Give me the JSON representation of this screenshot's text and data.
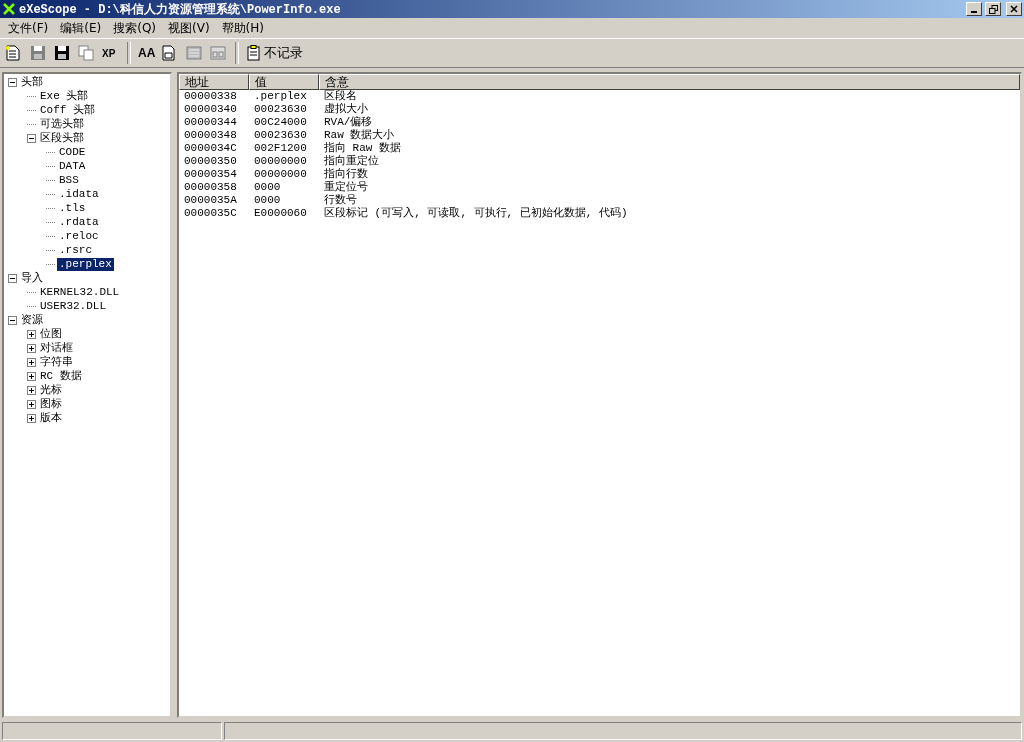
{
  "window": {
    "title": "eXeScope - D:\\科信人力资源管理系统\\PowerInfo.exe"
  },
  "menu": [
    {
      "label": "文件(F)"
    },
    {
      "label": "编辑(E)"
    },
    {
      "label": "搜索(Q)"
    },
    {
      "label": "视图(V)"
    },
    {
      "label": "帮助(H)"
    }
  ],
  "toolbar": [
    {
      "kind": "new",
      "disabled": false
    },
    {
      "kind": "save",
      "disabled": true
    },
    {
      "kind": "save",
      "disabled": false
    },
    {
      "kind": "copy",
      "disabled": true
    },
    {
      "kind": "xp",
      "label": "XP",
      "disabled": false
    },
    {
      "kind": "separator"
    },
    {
      "kind": "font",
      "label": "AA",
      "disabled": false
    },
    {
      "kind": "hex",
      "disabled": false
    },
    {
      "kind": "dump",
      "disabled": true
    },
    {
      "kind": "binary",
      "disabled": true
    },
    {
      "kind": "separator"
    },
    {
      "kind": "record",
      "label": "不记录",
      "disabled": false
    }
  ],
  "tree": [
    {
      "label": "头部",
      "expanded": true,
      "selected": false,
      "children": [
        {
          "label": "Exe 头部",
          "selected": false
        },
        {
          "label": "Coff 头部",
          "selected": false
        },
        {
          "label": "可选头部",
          "selected": false
        },
        {
          "label": "区段头部",
          "expanded": true,
          "selected": false,
          "children": [
            {
              "label": "CODE",
              "selected": false
            },
            {
              "label": "DATA",
              "selected": false
            },
            {
              "label": "BSS",
              "selected": false
            },
            {
              "label": ".idata",
              "selected": false
            },
            {
              "label": ".tls",
              "selected": false
            },
            {
              "label": ".rdata",
              "selected": false
            },
            {
              "label": ".reloc",
              "selected": false
            },
            {
              "label": ".rsrc",
              "selected": false
            },
            {
              "label": ".perplex",
              "selected": true
            }
          ]
        }
      ]
    },
    {
      "label": "导入",
      "expanded": true,
      "selected": false,
      "children": [
        {
          "label": "KERNEL32.DLL",
          "selected": false
        },
        {
          "label": "USER32.DLL",
          "selected": false
        }
      ]
    },
    {
      "label": "资源",
      "expanded": true,
      "selected": false,
      "children": [
        {
          "label": "位图",
          "expanded": false,
          "selected": false
        },
        {
          "label": "对话框",
          "expanded": false,
          "selected": false
        },
        {
          "label": "字符串",
          "expanded": false,
          "selected": false
        },
        {
          "label": "RC 数据",
          "expanded": false,
          "selected": false
        },
        {
          "label": "光标",
          "expanded": false,
          "selected": false
        },
        {
          "label": "图标",
          "expanded": false,
          "selected": false
        },
        {
          "label": "版本",
          "expanded": false,
          "selected": false
        }
      ]
    }
  ],
  "table": {
    "columns": [
      "地址",
      "值",
      "含意"
    ],
    "rows": [
      [
        "00000338",
        ".perplex",
        "区段名"
      ],
      [
        "00000340",
        "00023630",
        "虚拟大小"
      ],
      [
        "00000344",
        "00C24000",
        "RVA/偏移"
      ],
      [
        "00000348",
        "00023630",
        "Raw 数据大小"
      ],
      [
        "0000034C",
        "002F1200",
        "指向 Raw 数据"
      ],
      [
        "00000350",
        "00000000",
        "指向重定位"
      ],
      [
        "00000354",
        "00000000",
        "指向行数"
      ],
      [
        "00000358",
        "0000",
        "重定位号"
      ],
      [
        "0000035A",
        "0000",
        "行数号"
      ],
      [
        "0000035C",
        "E0000060",
        "区段标记 (可写入, 可读取, 可执行, 已初始化数据, 代码)"
      ]
    ]
  }
}
